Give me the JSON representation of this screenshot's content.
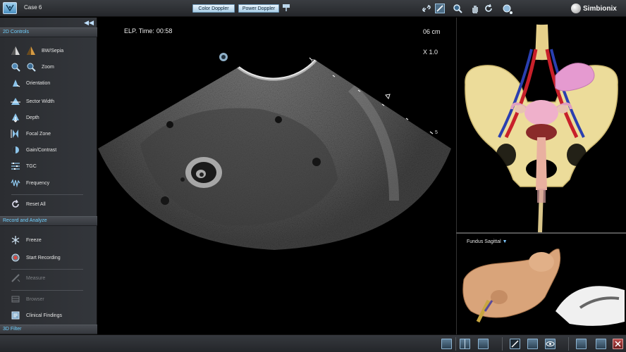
{
  "header": {
    "case_label": "Case 6",
    "color_doppler_label": "Color Doppler",
    "power_doppler_label": "Power Doppler",
    "brand": "Simbionix"
  },
  "left_panel": {
    "sections": {
      "controls_2d": "2D Controls",
      "record_analyze": "Record and Analyze",
      "filter_3d": "3D Filter"
    },
    "controls": {
      "bw_sepia": "BW/Sepia",
      "zoom": "Zoom",
      "orientation": "Orientation",
      "sector_width": "Sector Width",
      "depth": "Depth",
      "focal_zone": "Focal Zone",
      "gain_contrast": "Gain/Contrast",
      "tgc": "TGC",
      "frequency": "Frequency",
      "reset_all": "Reset All",
      "freeze": "Freeze",
      "start_recording": "Start Recording",
      "measure": "Measure",
      "browser": "Browser",
      "clinical_findings": "Clinical Findings"
    }
  },
  "ultrasound": {
    "elp_label": "ELP. Time:",
    "elp_time": "00:58",
    "depth": "06 cm",
    "zoom": "X 1.0",
    "scale_top": "0",
    "scale_bottom": "5"
  },
  "probe_panel": {
    "plane": "Fundus Sagittal"
  },
  "colors": {
    "section_header_text": "#6fd0ff",
    "accent": "#7fc9ff"
  }
}
